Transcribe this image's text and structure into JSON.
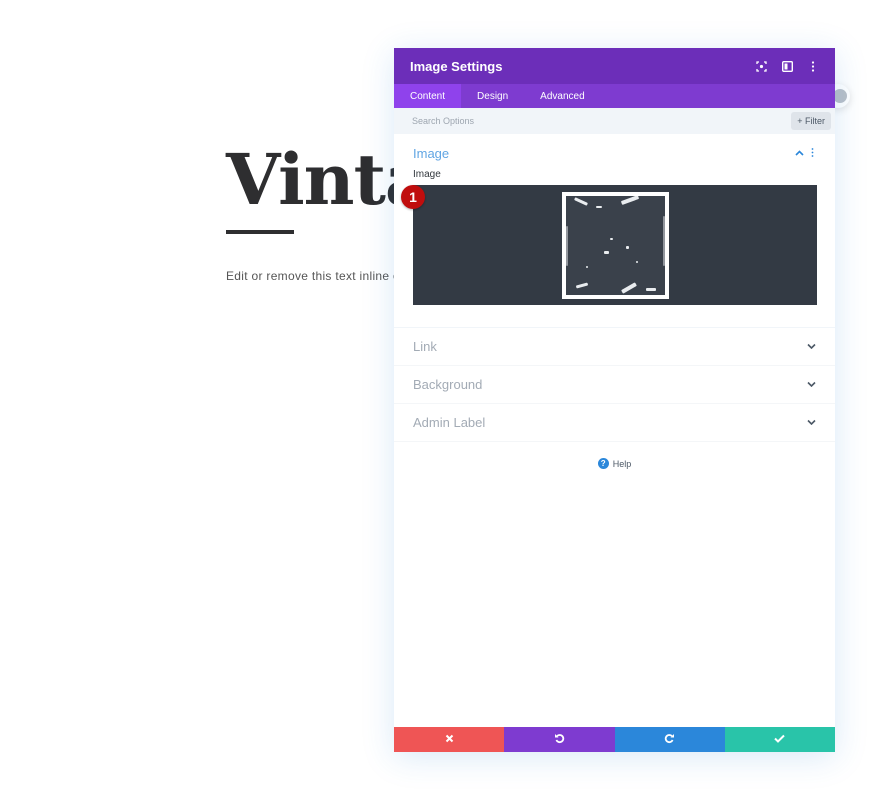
{
  "page": {
    "hero_title": "Vintag",
    "hero_text": "Edit or remove this text inline or"
  },
  "modal": {
    "title": "Image Settings",
    "header_icons": [
      "expand-icon",
      "split-view-icon",
      "more-options-icon"
    ],
    "tabs": [
      {
        "label": "Content",
        "active": true
      },
      {
        "label": "Design",
        "active": false
      },
      {
        "label": "Advanced",
        "active": false
      }
    ],
    "search": {
      "placeholder": "Search Options",
      "value": ""
    },
    "filter_label": "+ Filter",
    "sections": {
      "image": {
        "title": "Image",
        "field_label": "Image",
        "badge": "1",
        "expanded": true
      },
      "link": {
        "title": "Link",
        "expanded": false
      },
      "background": {
        "title": "Background",
        "expanded": false
      },
      "admin_label": {
        "title": "Admin Label",
        "expanded": false
      }
    },
    "help_label": "Help",
    "footer": {
      "discard": {
        "icon": "close-icon",
        "color": "#ef5555"
      },
      "undo": {
        "icon": "undo-icon",
        "color": "#7e3bd0"
      },
      "redo": {
        "icon": "redo-icon",
        "color": "#2b87da"
      },
      "save": {
        "icon": "check-icon",
        "color": "#29c4a9"
      }
    }
  },
  "colors": {
    "header": "#6c2eb9",
    "tabs": "#7e3bd0",
    "active_tab": "#8f42ec",
    "accent": "#2b87da",
    "badge": "#c00d0d"
  }
}
